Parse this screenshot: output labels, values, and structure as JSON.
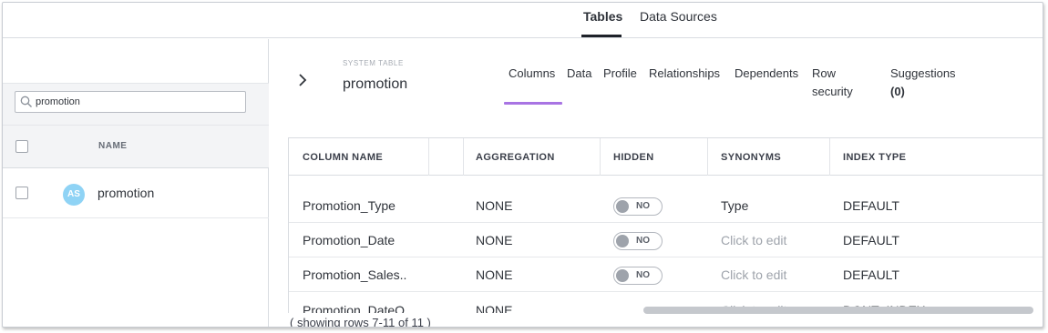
{
  "topnav": {
    "tabs": [
      {
        "label": "Tables",
        "active": true
      },
      {
        "label": "Data Sources",
        "active": false
      }
    ]
  },
  "sidebar": {
    "search": {
      "value": "promotion",
      "icon": "search-icon"
    },
    "header": {
      "name_col": "NAME"
    },
    "items": [
      {
        "avatar": "AS",
        "label": "promotion"
      }
    ]
  },
  "detail": {
    "type_label": "SYSTEM TABLE",
    "title": "promotion",
    "tabs": [
      {
        "label": "Columns",
        "active": true
      },
      {
        "label": "Data"
      },
      {
        "label": "Profile"
      },
      {
        "label": "Relationships"
      },
      {
        "label": "Dependents"
      },
      {
        "label": "Row security"
      },
      {
        "label": "Suggestions",
        "count": "(0)"
      }
    ]
  },
  "table": {
    "headers": [
      "COLUMN NAME",
      "AGGREGATION",
      "HIDDEN",
      "SYNONYMS",
      "INDEX TYPE"
    ],
    "rows": [
      {
        "column_name": "Promotion_Type",
        "aggregation": "NONE",
        "hidden": "NO",
        "synonyms": "Type",
        "synonyms_placeholder": false,
        "index_type": "DEFAULT"
      },
      {
        "column_name": "Promotion_Date",
        "aggregation": "NONE",
        "hidden": "NO",
        "synonyms": "Click to edit",
        "synonyms_placeholder": true,
        "index_type": "DEFAULT"
      },
      {
        "column_name": "Promotion_Sales..",
        "aggregation": "NONE",
        "hidden": "NO",
        "synonyms": "Click to edit",
        "synonyms_placeholder": true,
        "index_type": "DEFAULT"
      }
    ],
    "partial_row": {
      "column_name": "Promotion_DateO...",
      "aggregation": "NONE",
      "synonyms": "Click to edit",
      "index_type": "DONT_INDEX"
    },
    "footer": "( showing rows 7-11 of 11 )"
  },
  "colors": {
    "accent_underline": "#a874e3",
    "avatar_bg": "#8fd3f5"
  }
}
